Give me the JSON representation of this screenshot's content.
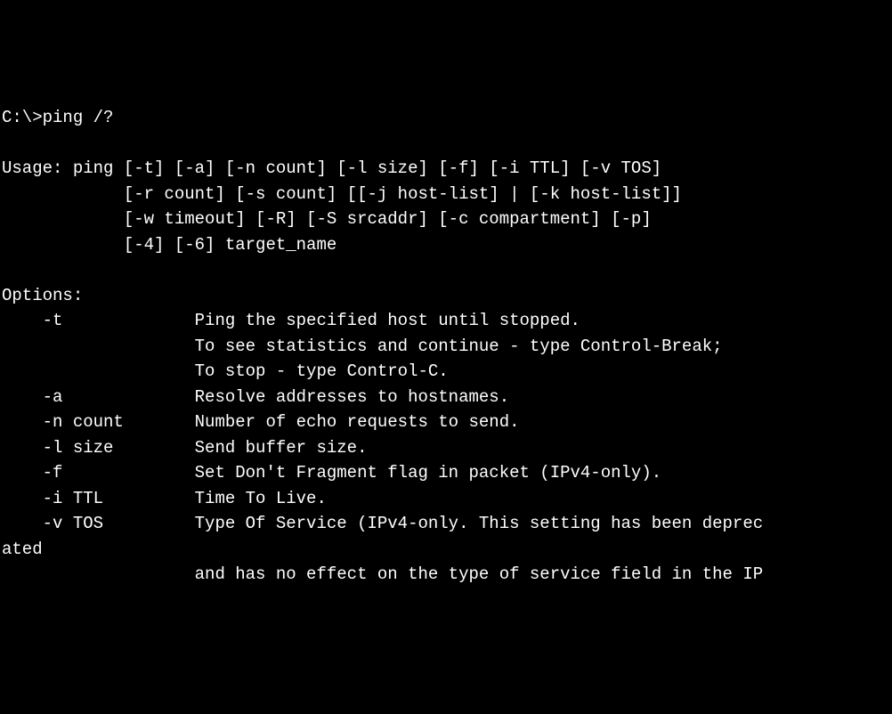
{
  "prompt": "C:\\>ping /?",
  "blank1": "",
  "usage1": "Usage: ping [-t] [-a] [-n count] [-l size] [-f] [-i TTL] [-v TOS]",
  "usage2": "            [-r count] [-s count] [[-j host-list] | [-k host-list]]",
  "usage3": "            [-w timeout] [-R] [-S srcaddr] [-c compartment] [-p]",
  "usage4": "            [-4] [-6] target_name",
  "blank2": "",
  "optionsHeader": "Options:",
  "opt_t1": "    -t             Ping the specified host until stopped.",
  "opt_t2": "                   To see statistics and continue - type Control-Break;",
  "opt_t3": "                   To stop - type Control-C.",
  "opt_a": "    -a             Resolve addresses to hostnames.",
  "opt_n": "    -n count       Number of echo requests to send.",
  "opt_l": "    -l size        Send buffer size.",
  "opt_f": "    -f             Set Don't Fragment flag in packet (IPv4-only).",
  "opt_i": "    -i TTL         Time To Live.",
  "opt_v1": "    -v TOS         Type Of Service (IPv4-only. This setting has been deprec",
  "opt_v2": "ated",
  "opt_v3": "                   and has no effect on the type of service field in the IP"
}
